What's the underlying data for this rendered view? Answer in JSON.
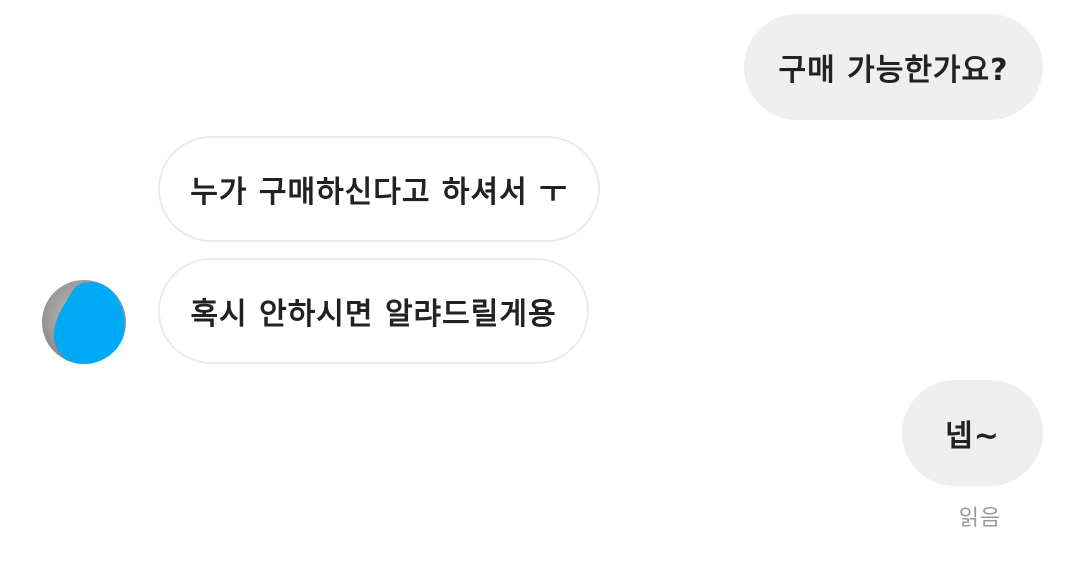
{
  "conversation": {
    "messages": [
      {
        "direction": "sent",
        "text": "구매 가능한가요?"
      },
      {
        "direction": "received",
        "text": "누가 구매하신다고 하셔서 ㅜ"
      },
      {
        "direction": "received",
        "text": "혹시 안하시면 알랴드릴게용"
      },
      {
        "direction": "sent",
        "text": "넵~"
      }
    ],
    "read_receipt": "읽음"
  },
  "colors": {
    "sent_bubble": "#efefef",
    "received_bubble": "#ffffff",
    "received_border": "#ebebeb",
    "avatar_redaction": "#00a9f4",
    "read_receipt": "#9a9a9a"
  },
  "icons": {
    "avatar": "profile-avatar-redacted"
  }
}
